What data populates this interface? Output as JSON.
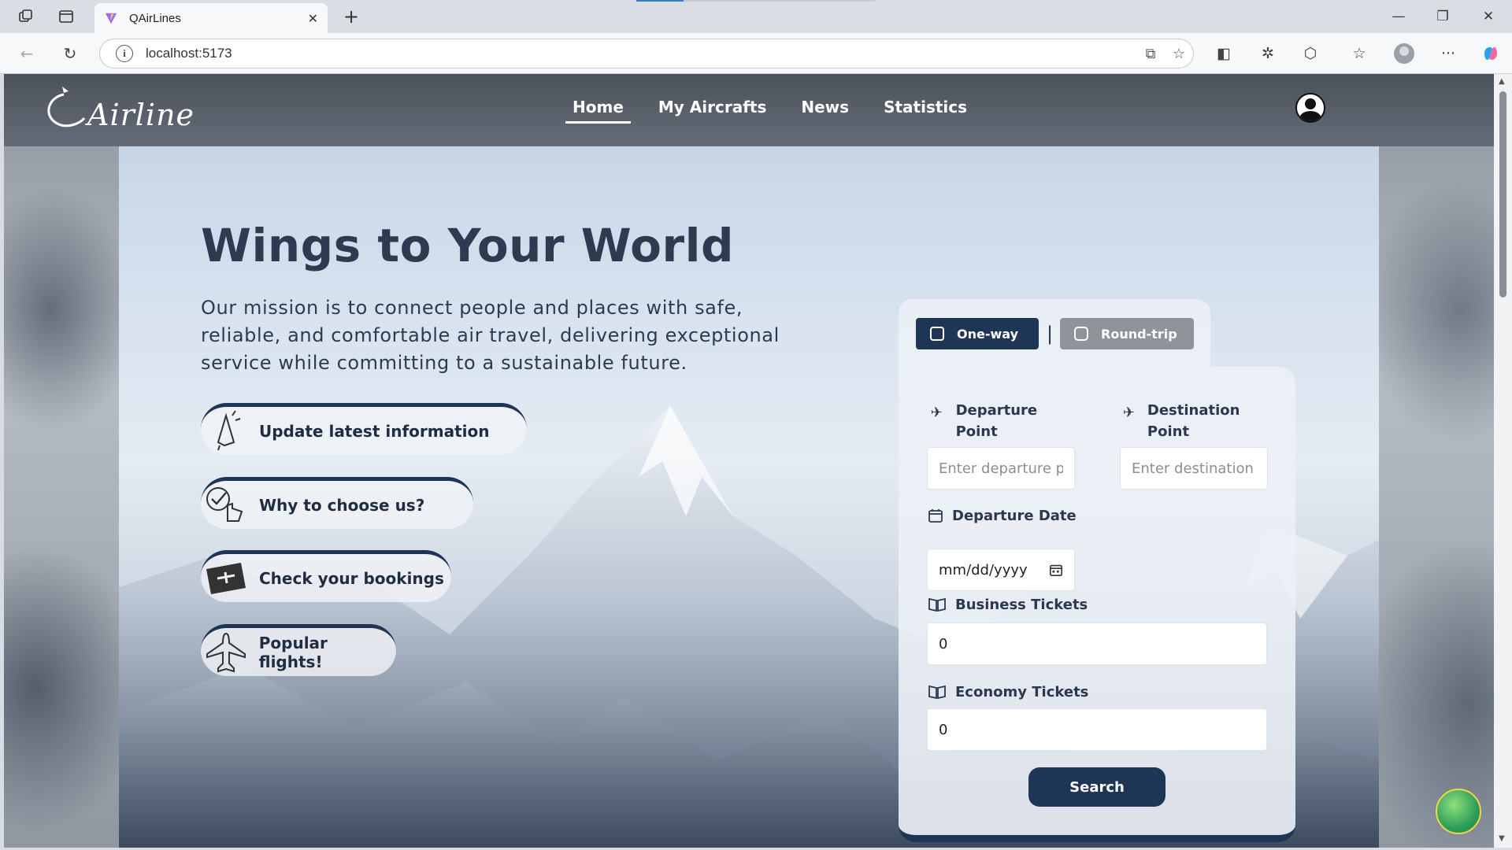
{
  "browser": {
    "tab_title": "QAirLines",
    "url": "localhost:5173"
  },
  "header": {
    "logo_text": "Airline",
    "nav": [
      {
        "label": "Home",
        "active": true
      },
      {
        "label": "My Aircrafts",
        "active": false
      },
      {
        "label": "News",
        "active": false
      },
      {
        "label": "Statistics",
        "active": false
      }
    ]
  },
  "hero": {
    "headline": "Wings to Your World",
    "mission": "Our mission is to connect people and places with safe, reliable, and comfortable air travel, delivering exceptional service while committing to a sustainable future.",
    "features": [
      {
        "label": "Update latest information",
        "icon": "megaphone-icon"
      },
      {
        "label": "Why to choose us?",
        "icon": "checklist-hand-icon"
      },
      {
        "label": "Check your bookings",
        "icon": "ticket-icon"
      },
      {
        "label": "Popular flights!",
        "icon": "airplane-icon"
      }
    ]
  },
  "booking": {
    "one_way_label": "One-way",
    "round_trip_label": "Round-trip",
    "separator": "|",
    "departure_label": "Departure Point",
    "departure_placeholder": "Enter departure point",
    "destination_label": "Destination Point",
    "destination_placeholder": "Enter destination point",
    "date_label": "Departure Date",
    "date_placeholder": "mm/dd/yyyy",
    "business_label": "Business Tickets",
    "business_value": "0",
    "economy_label": "Economy Tickets",
    "economy_value": "0",
    "search_label": "Search"
  },
  "colors": {
    "primary": "#1f3556",
    "text": "#2e3a4f",
    "secondary_button": "#8f949b"
  }
}
